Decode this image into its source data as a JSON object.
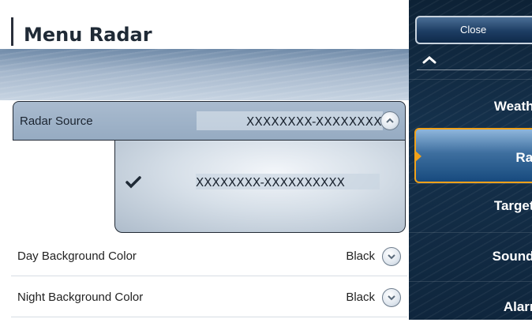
{
  "header": {
    "title": "Menu Radar"
  },
  "radar_source": {
    "label": "Radar Source",
    "value": "XXXXXXXX-XXXXXXXXXX",
    "options": [
      {
        "label": "XXXXXXXX-XXXXXXXXXX",
        "selected": true
      }
    ]
  },
  "settings": [
    {
      "label": "Day Background Color",
      "value": "Black"
    },
    {
      "label": "Night Background Color",
      "value": "Black"
    }
  ],
  "sidebar": {
    "close_label": "Close",
    "items": [
      {
        "label": "Weathe",
        "active": false
      },
      {
        "label": "Rada",
        "active": true
      },
      {
        "label": "Targets",
        "active": false
      },
      {
        "label": "Sounde",
        "active": false
      },
      {
        "label": "Alarm",
        "active": false
      }
    ]
  },
  "colors": {
    "accent_orange": "#f0a11a",
    "sidebar_navy": "#15314c",
    "active_blue": "#3e6f9f"
  }
}
